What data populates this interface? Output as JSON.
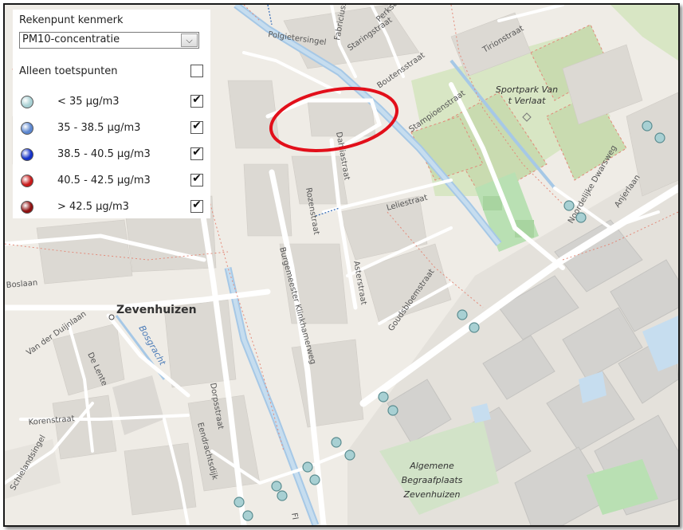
{
  "panel": {
    "title": "Rekenpunt kenmerk",
    "select_value": "PM10-concentratie",
    "only_test_points_label": "Alleen toetspunten",
    "only_test_points_checked": false,
    "legend": [
      {
        "label": "< 35 µg/m3",
        "color": "#a8d0d3",
        "checked": true
      },
      {
        "label": "35 - 38.5 µg/m3",
        "color": "#5b86cf",
        "checked": true
      },
      {
        "label": "38.5 - 40.5 µg/m3",
        "color": "#1431c8",
        "checked": true
      },
      {
        "label": "40.5 - 42.5 µg/m3",
        "color": "#c81a1a",
        "checked": true
      },
      {
        "label": "> 42.5 µg/m3",
        "color": "#8e1010",
        "checked": true
      }
    ]
  },
  "map": {
    "place": "Zevenhuizen",
    "water": "Bosgracht",
    "park": [
      "Sportpark Van",
      "t Verlaat"
    ],
    "cemetery": [
      "Algemene",
      "Begraafplaats",
      "Zevenhuizen"
    ],
    "streets": {
      "s1": "Polgietersingel",
      "s2": "Fabriciusstraat",
      "s3": "Staringstraat",
      "s4": "Perkstraat",
      "s5": "Boutensstraat",
      "s6": "Tirionstraat",
      "s7": "Stampioenstraat",
      "s8": "Dahliastraat",
      "s9": "Leliestraat",
      "s10": "Rozenstraat",
      "s11": "Burgemeester Klinkhamerweg",
      "s12": "Asterstraat",
      "s13": "Goudsbloemstraat",
      "s14": "Noordelijke Dwarsweg",
      "s15": "Anjerlaan",
      "s16": "Boslaan",
      "s17": "Van der Duijnlaan",
      "s18": "De Lente",
      "s19": "Dorpsstraat",
      "s20": "Eendrachtsdijk",
      "s21": "Korenstraat",
      "s22": "Schielandsingel",
      "s23": "Fl"
    },
    "marker_color": "#a8d0d3"
  }
}
